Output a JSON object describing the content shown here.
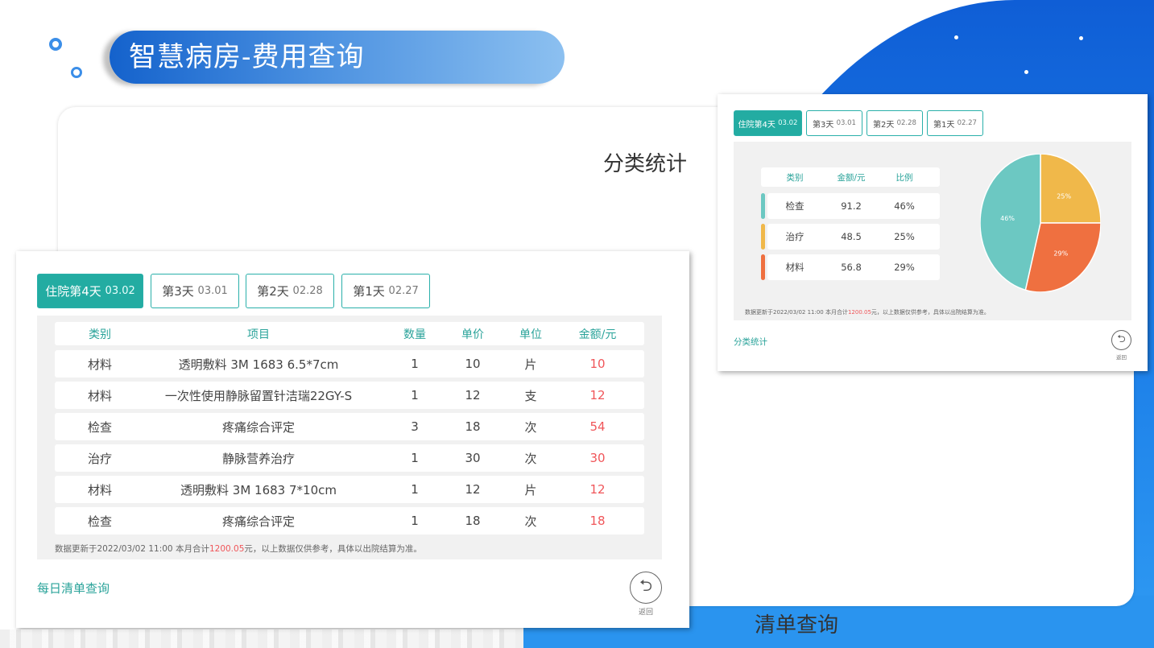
{
  "title": "智慧病房-费用查询",
  "captions": {
    "classify": "分类统计",
    "list": "清单查询"
  },
  "colors": {
    "teal": "#23aca2",
    "red": "#f0565a",
    "exam": "#6cc8c2",
    "treat": "#f0b84a",
    "material": "#ef7040"
  },
  "tabs": [
    {
      "label": "住院第4天",
      "date": "03.02"
    },
    {
      "label": "第3天",
      "date": "03.01"
    },
    {
      "label": "第2天",
      "date": "02.28"
    },
    {
      "label": "第1天",
      "date": "02.27"
    }
  ],
  "list": {
    "headers": [
      "类别",
      "项目",
      "数量",
      "单价",
      "单位",
      "金额/元"
    ],
    "rows": [
      {
        "category": "材料",
        "item": "透明敷料 3M 1683 6.5*7cm",
        "qty": "1",
        "price": "10",
        "unit": "片",
        "amount": "10"
      },
      {
        "category": "材料",
        "item": "一次性使用静脉留置针洁瑞22GY-S",
        "qty": "1",
        "price": "12",
        "unit": "支",
        "amount": "12"
      },
      {
        "category": "检查",
        "item": "疼痛综合评定",
        "qty": "3",
        "price": "18",
        "unit": "次",
        "amount": "54"
      },
      {
        "category": "治疗",
        "item": "静脉营养治疗",
        "qty": "1",
        "price": "30",
        "unit": "次",
        "amount": "30"
      },
      {
        "category": "材料",
        "item": "透明敷料 3M 1683 7*10cm",
        "qty": "1",
        "price": "12",
        "unit": "片",
        "amount": "12"
      },
      {
        "category": "检查",
        "item": "疼痛综合评定",
        "qty": "1",
        "price": "18",
        "unit": "次",
        "amount": "18"
      }
    ],
    "note_prefix": "数据更新于2022/03/02 11:00 本月合计",
    "note_total": "1200.05",
    "note_suffix": "元，以上数据仅供参考，具体以出院结算为准。",
    "link": "每日清单查询",
    "back_label": "返回"
  },
  "stats": {
    "headers": [
      "类别",
      "金额/元",
      "比例"
    ],
    "rows": [
      {
        "category": "检查",
        "amount": "91.2",
        "ratio": "46%"
      },
      {
        "category": "治疗",
        "amount": "48.5",
        "ratio": "25%"
      },
      {
        "category": "材料",
        "amount": "56.8",
        "ratio": "29%"
      }
    ],
    "note_prefix": "数据更新于2022/03/02 11:00 本月合计",
    "note_total": "1200.05",
    "note_suffix": "元，以上数据仅供参考，具体以出院结算为准。",
    "link": "分类统计",
    "back_label": "返回"
  },
  "chart_data": {
    "type": "pie",
    "categories": [
      "检查",
      "治疗",
      "材料"
    ],
    "values": [
      46,
      25,
      29
    ],
    "labels": [
      "46%",
      "25%",
      "29%"
    ],
    "colors": [
      "#6cc8c2",
      "#f0b84a",
      "#ef7040"
    ]
  }
}
